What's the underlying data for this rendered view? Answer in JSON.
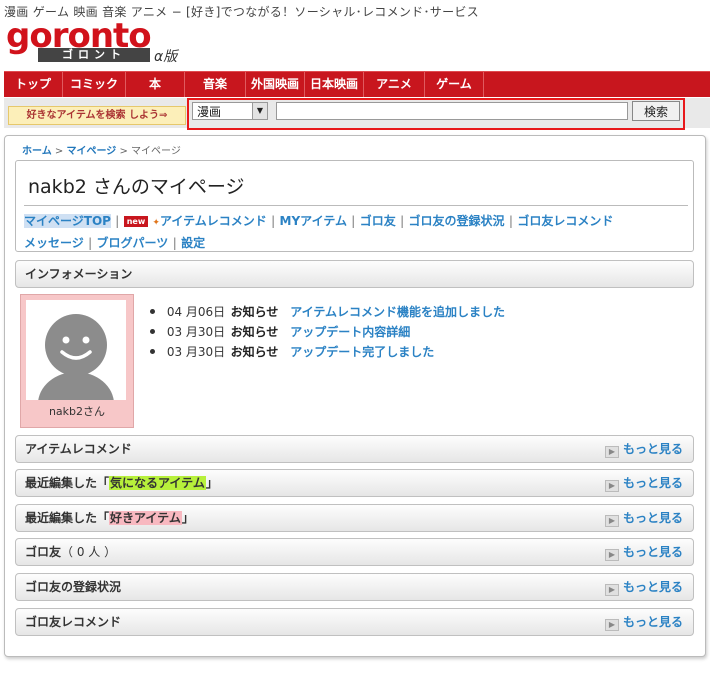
{
  "header": {
    "tagline": "漫画 ゲーム 映画 音楽 アニメ − [好き]でつながる！ソーシャル･レコメンド･サービス",
    "logo_word": "goronto",
    "logo_kana": "ゴロント",
    "logo_version": "α版"
  },
  "nav": {
    "items": [
      "トップ",
      "コミック",
      "本",
      "音楽",
      "外国映画",
      "日本映画",
      "アニメ",
      "ゲーム"
    ]
  },
  "search": {
    "hint": "好きなアイテムを検索 しよう⇒",
    "category_selected": "漫画",
    "query_value": "",
    "button_label": "検索"
  },
  "breadcrumb": {
    "home": "ホーム",
    "mypage": "マイページ",
    "current": "マイページ",
    "sep": ">"
  },
  "profile": {
    "page_title": "nakb2  さんのマイページ",
    "avatar_name": "nakb2さん"
  },
  "mypage_links": {
    "mypage_top": "マイページTOP",
    "new_badge": "new",
    "item_recommend": "アイテムレコメンド",
    "my_items": "MYアイテム",
    "goro_friends": "ゴロ友",
    "friend_status": "ゴロ友の登録状況",
    "friend_recommend": "ゴロ友レコメンド",
    "messages": "メッセージ",
    "blog_parts": "ブログパーツ",
    "settings": "設定",
    "sep": "|"
  },
  "information": {
    "title": "インフォメーション",
    "news": [
      {
        "date": "04 月06日",
        "tag": "お知らせ",
        "text": "アイテムレコメンド機能を追加しました"
      },
      {
        "date": "03 月30日",
        "tag": "お知らせ",
        "text": "アップデート内容詳細"
      },
      {
        "date": "03 月30日",
        "tag": "お知らせ",
        "text": "アップデート完了しました"
      }
    ]
  },
  "sections": {
    "more_label": "もっと見る",
    "item_recommend": {
      "title": "アイテムレコメンド"
    },
    "recent_interested": {
      "prefix": "最近編集した「",
      "highlight": "気になるアイテム",
      "suffix": "」"
    },
    "recent_liked": {
      "prefix": "最近編集した「",
      "highlight": "好きアイテム",
      "suffix": "」"
    },
    "friends": {
      "title": "ゴロ友",
      "count": "（ 0 人 ）"
    },
    "friend_status": {
      "title": "ゴロ友の登録状況"
    },
    "friend_recommend": {
      "title": "ゴロ友レコメンド"
    }
  },
  "colors": {
    "brand_red": "#c8161e",
    "link_blue": "#2b82c4",
    "highlight_green": "#b7f03b",
    "highlight_pink": "#f8b8c0"
  }
}
